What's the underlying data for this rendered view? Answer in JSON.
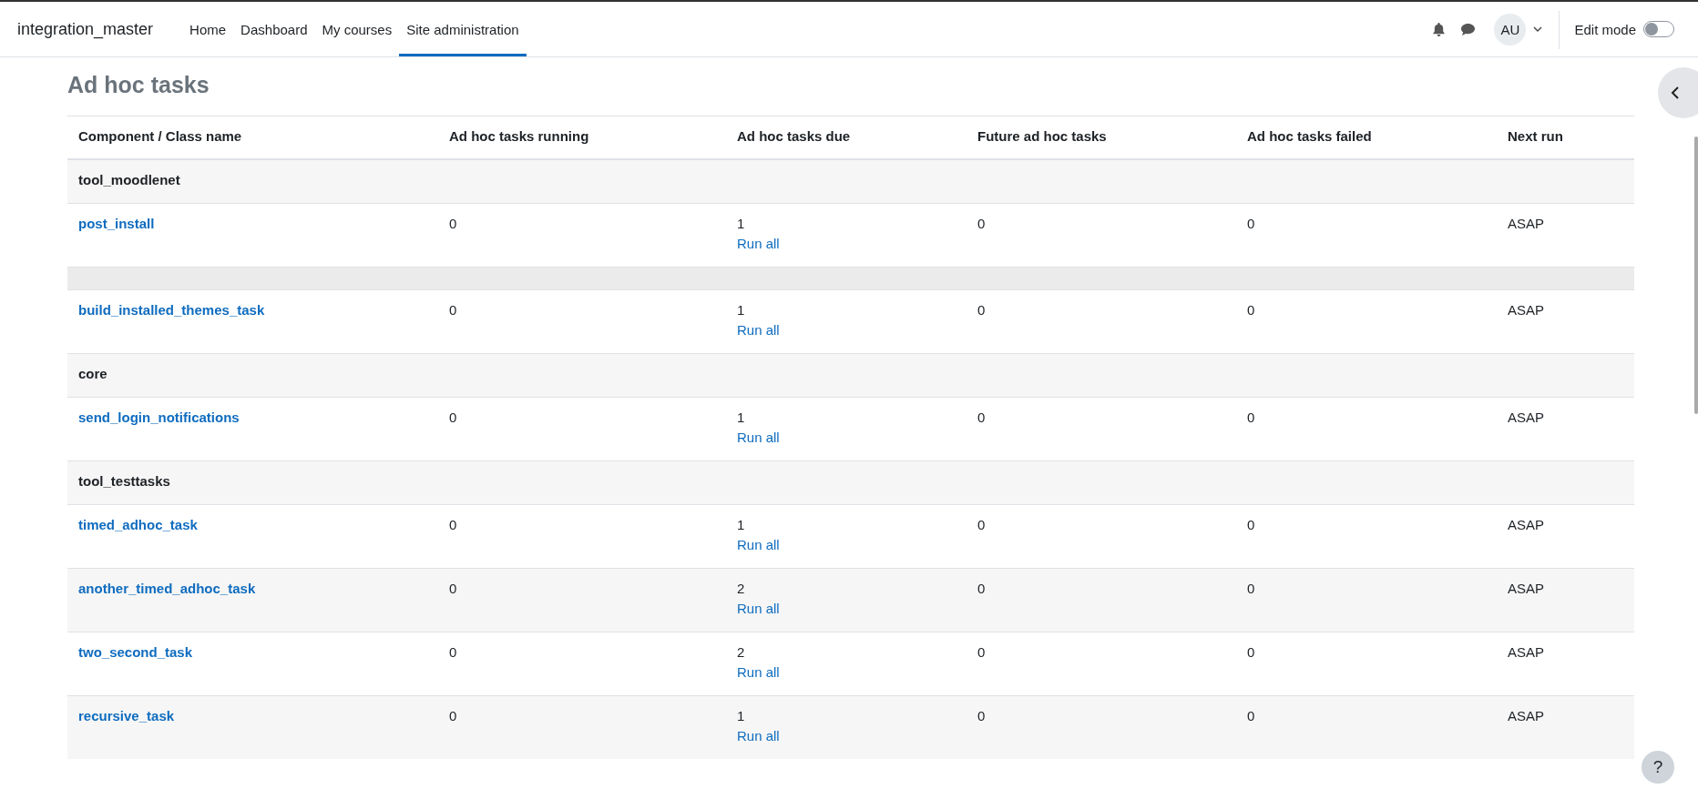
{
  "navbar": {
    "site_name": "integration_master",
    "items": [
      {
        "label": "Home",
        "selected": false
      },
      {
        "label": "Dashboard",
        "selected": false
      },
      {
        "label": "My courses",
        "selected": false
      },
      {
        "label": "Site administration",
        "selected": true
      }
    ],
    "avatar": "AU",
    "edit_mode": {
      "label": "Edit mode",
      "on": false
    }
  },
  "page_title": "Ad hoc tasks",
  "table": {
    "columns": [
      "Component / Class name",
      "Ad hoc tasks running",
      "Ad hoc tasks due",
      "Future ad hoc tasks",
      "Ad hoc tasks failed",
      "Next run"
    ],
    "rows": [
      {
        "kind": "group",
        "name": "tool_moodlenet"
      },
      {
        "kind": "task",
        "name": "post_install",
        "running": "0",
        "due": "1",
        "action": "Run all",
        "future": "0",
        "failed": "0",
        "next_run": "ASAP"
      },
      {
        "kind": "blank"
      },
      {
        "kind": "task",
        "name": "build_installed_themes_task",
        "running": "0",
        "due": "1",
        "action": "Run all",
        "future": "0",
        "failed": "0",
        "next_run": "ASAP"
      },
      {
        "kind": "group",
        "name": "core"
      },
      {
        "kind": "task",
        "name": "send_login_notifications",
        "running": "0",
        "due": "1",
        "action": "Run all",
        "future": "0",
        "failed": "0",
        "next_run": "ASAP"
      },
      {
        "kind": "group",
        "name": "tool_testtasks"
      },
      {
        "kind": "task",
        "name": "timed_adhoc_task",
        "running": "0",
        "due": "1",
        "action": "Run all",
        "future": "0",
        "failed": "0",
        "next_run": "ASAP"
      },
      {
        "kind": "task",
        "name": "another_timed_adhoc_task",
        "running": "0",
        "due": "2",
        "action": "Run all",
        "future": "0",
        "failed": "0",
        "next_run": "ASAP"
      },
      {
        "kind": "task",
        "name": "two_second_task",
        "running": "0",
        "due": "2",
        "action": "Run all",
        "future": "0",
        "failed": "0",
        "next_run": "ASAP"
      },
      {
        "kind": "task",
        "name": "recursive_task",
        "running": "0",
        "due": "1",
        "action": "Run all",
        "future": "0",
        "failed": "0",
        "next_run": "ASAP"
      }
    ]
  },
  "help_button": "?"
}
